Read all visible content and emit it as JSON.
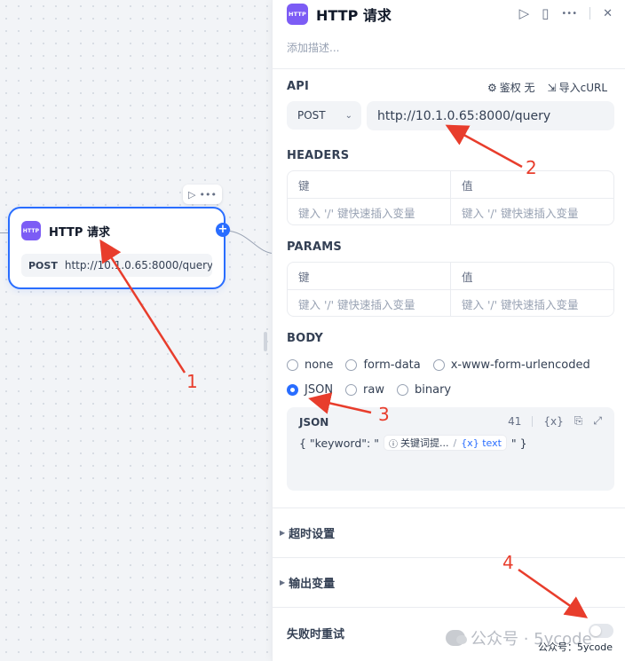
{
  "canvas": {
    "node": {
      "badge": "HTTP",
      "title": "HTTP 请求",
      "method": "POST",
      "url": "http://10.1.0.65:8000/query"
    },
    "toolbar": {
      "run_icon": "play-icon",
      "more_icon": "more-icon",
      "more": "•••"
    },
    "plus": "+"
  },
  "panel": {
    "badge": "HTTP",
    "title": "HTTP 请求",
    "description_placeholder": "添加描述...",
    "actions": {
      "run": "▷",
      "doc": "▯",
      "more": "•••",
      "close": "✕"
    },
    "api": {
      "label": "API",
      "auth_label": "鉴权 无",
      "import_label": "导入cURL",
      "method": "POST",
      "url": "http://10.1.0.65:8000/query"
    },
    "headers": {
      "label": "HEADERS",
      "key_header": "键",
      "value_header": "值",
      "key_placeholder": "键入 '/' 键快速插入变量",
      "value_placeholder": "键入 '/' 键快速插入变量"
    },
    "params": {
      "label": "PARAMS",
      "key_header": "键",
      "value_header": "值",
      "key_placeholder": "键入 '/' 键快速插入变量",
      "value_placeholder": "键入 '/' 键快速插入变量"
    },
    "body": {
      "label": "BODY",
      "options": [
        "none",
        "form-data",
        "x-www-form-urlencoded",
        "JSON",
        "raw",
        "binary"
      ],
      "selected": "JSON",
      "json": {
        "label": "JSON",
        "count": "41",
        "var_icon": "{x}",
        "prefix": "{ \"keyword\": \"",
        "chip_node": "关键词提...",
        "chip_var": "{x} text",
        "suffix": "\" }"
      }
    },
    "timeout_label": "超时设置",
    "output_label": "输出变量",
    "retry_label": "失败时重试",
    "retry_enabled": false
  },
  "annotations": {
    "n1": "1",
    "n2": "2",
    "n3": "3",
    "n4": "4",
    "color": "#e83d2c"
  },
  "watermark": {
    "text": "公众号 · 5ycode",
    "small": "公众号：5ycode"
  },
  "colors": {
    "accent": "#296dff",
    "badge": "#7c5cf5"
  }
}
